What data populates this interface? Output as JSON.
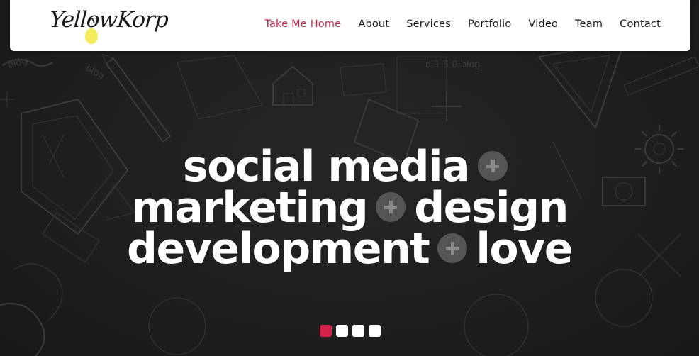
{
  "header": {
    "logo_text": "YellowKorp",
    "logo_icon": "lightbulb-icon",
    "nav": [
      {
        "label": "Take Me Home",
        "active": true
      },
      {
        "label": "About",
        "active": false
      },
      {
        "label": "Services",
        "active": false
      },
      {
        "label": "Portfolio",
        "active": false
      },
      {
        "label": "Video",
        "active": false
      },
      {
        "label": "Team",
        "active": false
      },
      {
        "label": "Contact",
        "active": false
      }
    ]
  },
  "hero": {
    "line1": {
      "word1": "social media"
    },
    "line2": {
      "word1": "marketing",
      "word2": "design"
    },
    "line3": {
      "word1": "development",
      "word2": "love"
    },
    "separator_icon": "plus-circle-icon",
    "slides_total": 4,
    "active_slide": 1
  },
  "colors": {
    "accent": "#c8294b",
    "slider_active": "#d4234a",
    "background": "#1d1d1d",
    "separator": "#555555",
    "logo_bulb": "#f5e94a"
  }
}
